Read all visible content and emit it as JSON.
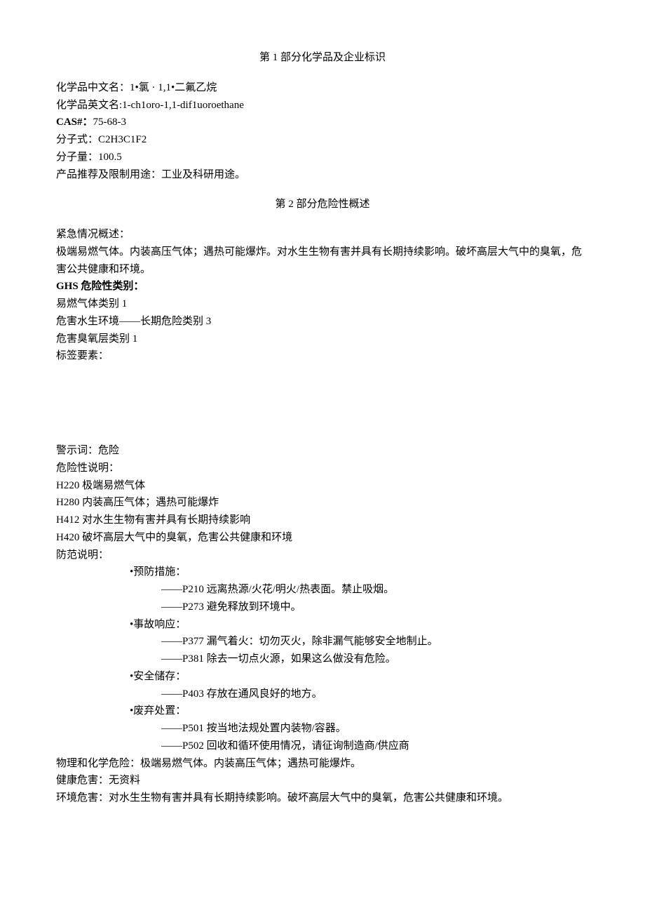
{
  "section1": {
    "title": "第 1 部分化学品及企业标识",
    "name_cn_label": "化学品中文名：",
    "name_cn_value": "1•氯 · 1,1•二氟乙烷",
    "name_en_label": "化学品英文名:",
    "name_en_value": "1-ch1oro-1,1-dif1uoroethane",
    "cas_label": "CAS#：",
    "cas_value": "75-68-3",
    "formula_label": "分子式：",
    "formula_value": "C2H3C1F2",
    "mw_label": "分子量：",
    "mw_value": "100.5",
    "use_label": "产品推荐及限制用途：",
    "use_value": "工业及科研用途。"
  },
  "section2": {
    "title": "第 2 部分危险性概述",
    "emergency_label": "紧急情况概述：",
    "emergency_text": "极端易燃气体。内装高压气体；遇热可能爆炸。对水生生物有害并具有长期持续影响。破坏高层大气中的臭氧，危害公共健康和环境。",
    "ghs_label": "GHS 危险性类别：",
    "ghs1": "易燃气体类别 1",
    "ghs2": "危害水生环境——长期危险类别 3",
    "ghs3": "危害臭氧层类别 1",
    "label_elements": "标签要素：",
    "signal_word": "警示词：危险",
    "hazard_statement_label": "危险性说明：",
    "h220": "H220 极端易燃气体",
    "h280": "H280 内装高压气体；遇热可能爆炸",
    "h412": "H412 对水生生物有害并具有长期持续影响",
    "h420": "H420 破坏高层大气中的臭氧，危害公共健康和环境",
    "precaution_label": "防范说明：",
    "prevention_label": "•预防措施：",
    "p210": "——P210 远离热源/火花/明火/热表面。禁止吸烟。",
    "p273": "——P273 避免释放到环境中。",
    "response_label": "•事故响应：",
    "p377": "——P377 漏气着火：切勿灭火，除非漏气能够安全地制止。",
    "p381": "——P381 除去一切点火源，如果这么做没有危险。",
    "storage_label": "•安全储存：",
    "p403": "——P403 存放在通风良好的地方。",
    "disposal_label": "•废弃处置：",
    "p501": "——P501 按当地法规处置内装物/容器。",
    "p502": "——P502 回收和循环使用情况，请征询制造商/供应商",
    "phys_chem": "物理和化学危险：极端易燃气体。内装高压气体；遇热可能爆炸。",
    "health": "健康危害：无资料",
    "env": "环境危害：对水生生物有害并具有长期持续影响。破坏高层大气中的臭氧，危害公共健康和环境。"
  }
}
